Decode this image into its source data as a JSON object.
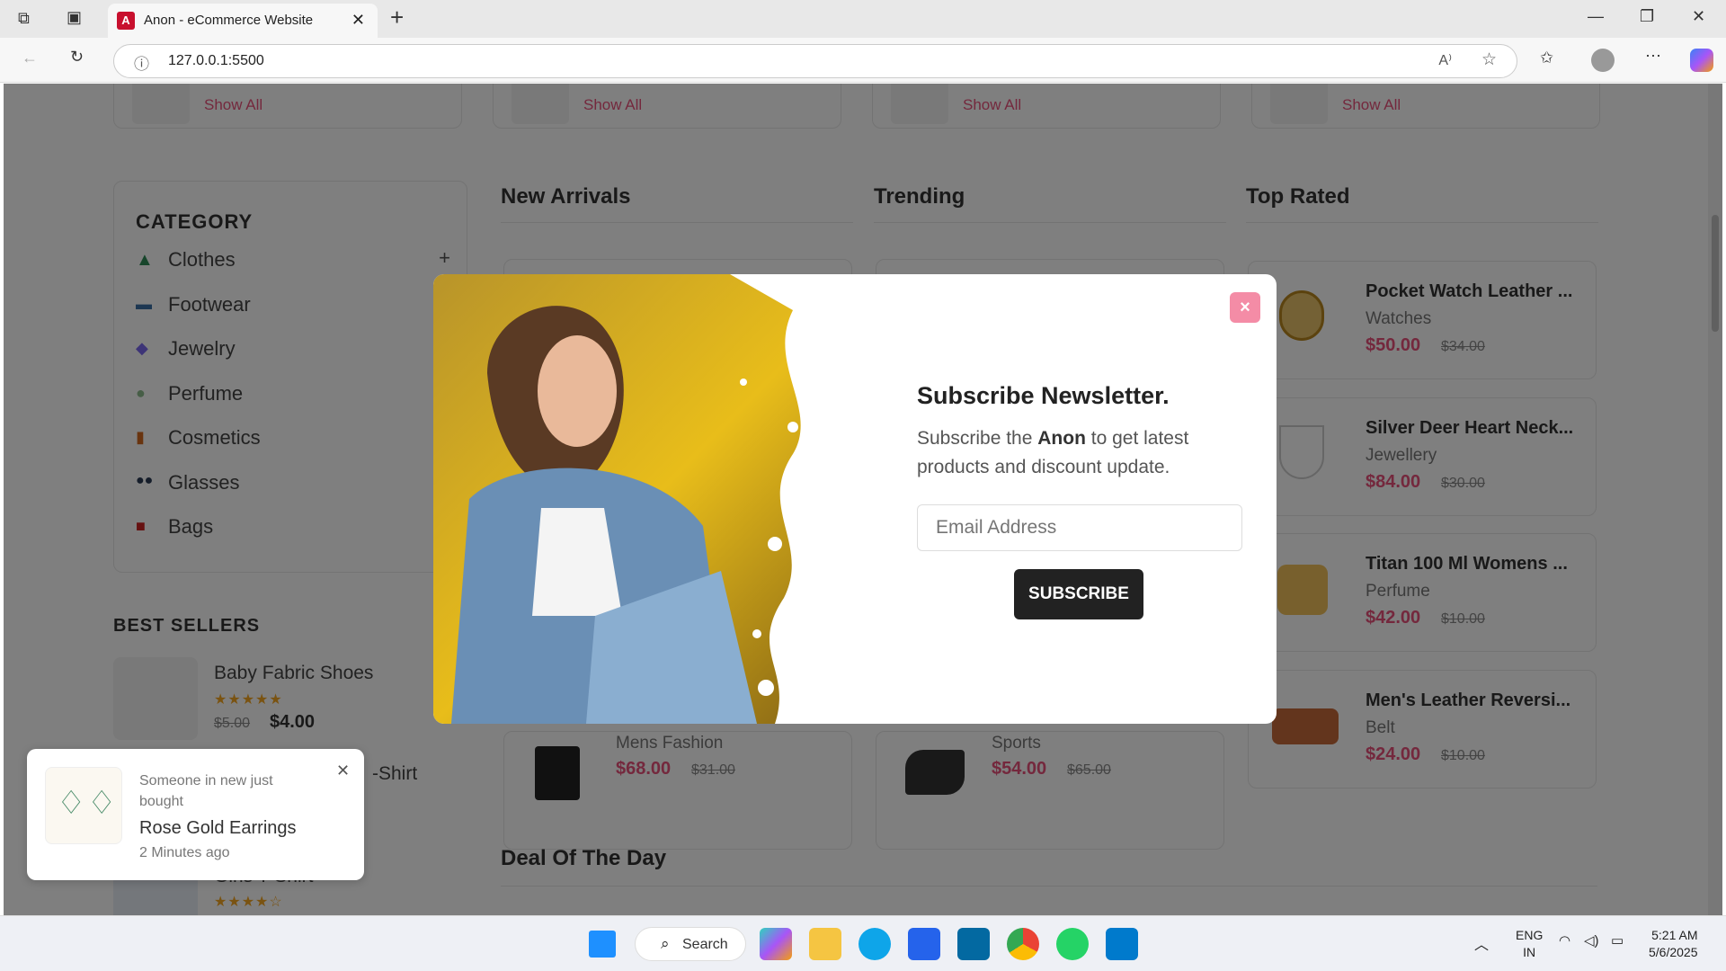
{
  "browser": {
    "tab_title": "Anon - eCommerce Website",
    "url": "127.0.0.1:5500",
    "new_tab": "+",
    "close": "✕"
  },
  "top_cards": [
    {
      "link": "Show All"
    },
    {
      "link": "Show All"
    },
    {
      "link": "Show All"
    },
    {
      "link": "Show All"
    }
  ],
  "sidebar": {
    "title": "CATEGORY",
    "plus": "+",
    "items": [
      {
        "label": "Clothes",
        "icon": "dress-icon"
      },
      {
        "label": "Footwear",
        "icon": "shoe-icon"
      },
      {
        "label": "Jewelry",
        "icon": "jewelry-icon"
      },
      {
        "label": "Perfume",
        "icon": "perfume-icon"
      },
      {
        "label": "Cosmetics",
        "icon": "cosmetics-icon"
      },
      {
        "label": "Glasses",
        "icon": "glasses-icon"
      },
      {
        "label": "Bags",
        "icon": "bag-icon"
      }
    ]
  },
  "best_sellers": {
    "title": "BEST SELLERS",
    "items": [
      {
        "name": "Baby Fabric Shoes",
        "stars": "★★★★★",
        "old": "$5.00",
        "price": "$4.00"
      },
      {
        "name": "-Shirt"
      },
      {
        "name": "Girls T-Shirt",
        "stars": "★★★★☆"
      }
    ]
  },
  "sections": {
    "new_arrivals": "New Arrivals",
    "trending": "Trending",
    "top_rated": "Top Rated",
    "deal": "Deal Of The Day"
  },
  "new_arrivals_visible": {
    "category": "Mens Fashion",
    "price": "$68.00",
    "old": "$31.00"
  },
  "trending_visible": {
    "category": "Sports",
    "price": "$54.00",
    "old": "$65.00"
  },
  "top_rated": [
    {
      "name": "Pocket Watch Leather ...",
      "category": "Watches",
      "price": "$50.00",
      "old": "$34.00"
    },
    {
      "name": "Silver Deer Heart Neck...",
      "category": "Jewellery",
      "price": "$84.00",
      "old": "$30.00"
    },
    {
      "name": "Titan 100 Ml Womens ...",
      "category": "Perfume",
      "price": "$42.00",
      "old": "$10.00"
    },
    {
      "name": "Men's Leather Reversi...",
      "category": "Belt",
      "price": "$24.00",
      "old": "$10.00"
    }
  ],
  "newsletter": {
    "title": "Subscribe Newsletter.",
    "desc_pre": "Subscribe the ",
    "desc_brand": "Anon",
    "desc_post": " to get latest products and discount update.",
    "email_placeholder": "Email Address",
    "button": "SUBSCRIBE",
    "close": "×"
  },
  "toast": {
    "line": "Someone in new just bought",
    "product": "Rose Gold Earrings",
    "time": "2 Minutes ago",
    "close": "✕"
  },
  "taskbar": {
    "search": "Search",
    "lang1": "ENG",
    "lang2": "IN",
    "time": "5:21 AM",
    "date": "5/6/2025"
  }
}
